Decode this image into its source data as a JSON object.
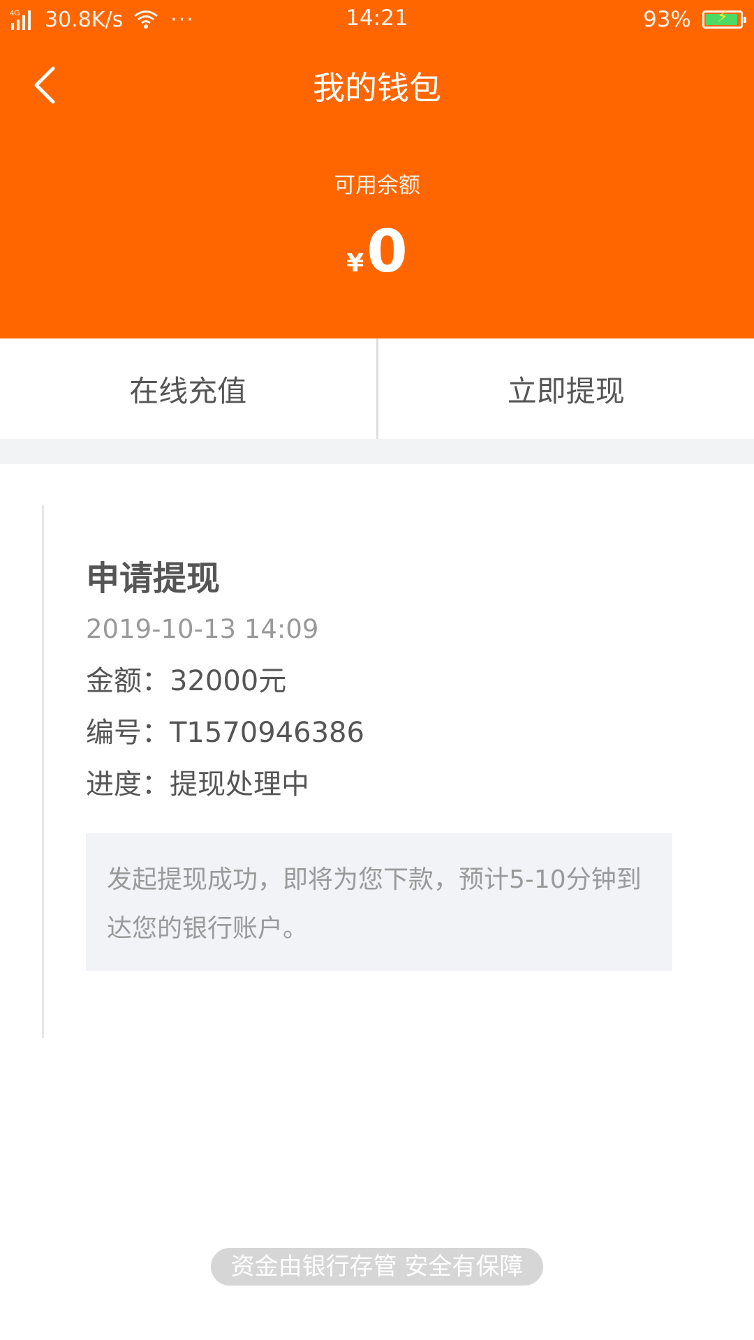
{
  "status_bar": {
    "network_type": "4G",
    "net_speed": "30.8K/s",
    "dots": "···",
    "time": "14:21",
    "battery_percent": "93%",
    "battery_level": 0.93
  },
  "nav": {
    "title": "我的钱包"
  },
  "balance": {
    "label": "可用余额",
    "currency": "¥",
    "value": "0"
  },
  "actions": {
    "recharge_label": "在线充值",
    "withdraw_label": "立即提现"
  },
  "record": {
    "title": "申请提现",
    "time": "2019-10-13 14:09",
    "amount_line": "金额：32000元",
    "number_line": "编号：T1570946386",
    "progress_line": "进度：提现处理中",
    "notice": "发起提现成功，即将为您下款，预计5-10分钟到达您的银行账户。"
  },
  "footer": {
    "guarantee_text": "资金由银行存管 安全有保障"
  },
  "colors": {
    "header_bg": "#ff6600",
    "battery_green": "#4cd964"
  },
  "icons": {
    "back": "chevron-left-icon",
    "signal": "signal-icon",
    "wifi": "wifi-icon",
    "battery": "battery-icon"
  }
}
